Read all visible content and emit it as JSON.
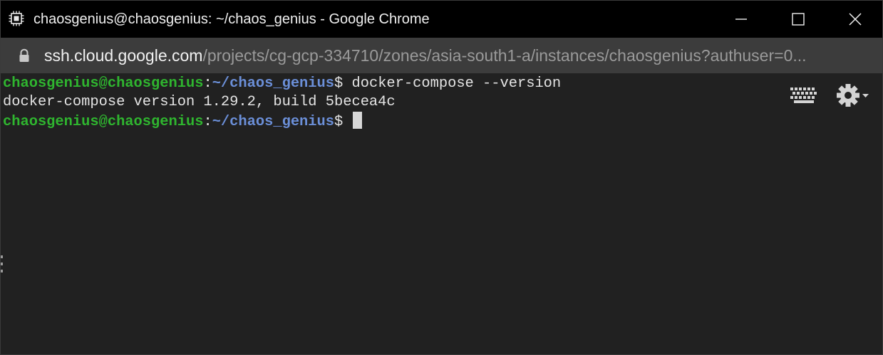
{
  "window": {
    "title": "chaosgenius@chaosgenius: ~/chaos_genius - Google Chrome",
    "icon": "chip-icon",
    "controls": [
      "minimize-icon",
      "maximize-icon",
      "close-icon"
    ]
  },
  "addressbar": {
    "lock_icon": "lock-icon",
    "domain": "ssh.cloud.google.com",
    "path": "/projects/cg-gcp-334710/zones/asia-south1-a/instances/chaosgenius?authuser=0..."
  },
  "terminal": {
    "prompt": {
      "user_host": "chaosgenius@chaosgenius",
      "colon": ":",
      "path": "~/chaos_genius",
      "symbol": "$ "
    },
    "lines": [
      {
        "command": "docker-compose --version"
      },
      {
        "output": "docker-compose version 1.29.2, build 5becea4c"
      },
      {
        "command": ""
      }
    ],
    "toolbar_icons": [
      "keyboard-icon",
      "gear-icon"
    ]
  },
  "colors": {
    "titlebar_bg": "#000000",
    "addressbar_bg": "#3c3c3c",
    "terminal_bg": "#212121",
    "prompt_user": "#2fb52f",
    "prompt_path": "#6b8fd8",
    "text": "#e4e4e4"
  }
}
